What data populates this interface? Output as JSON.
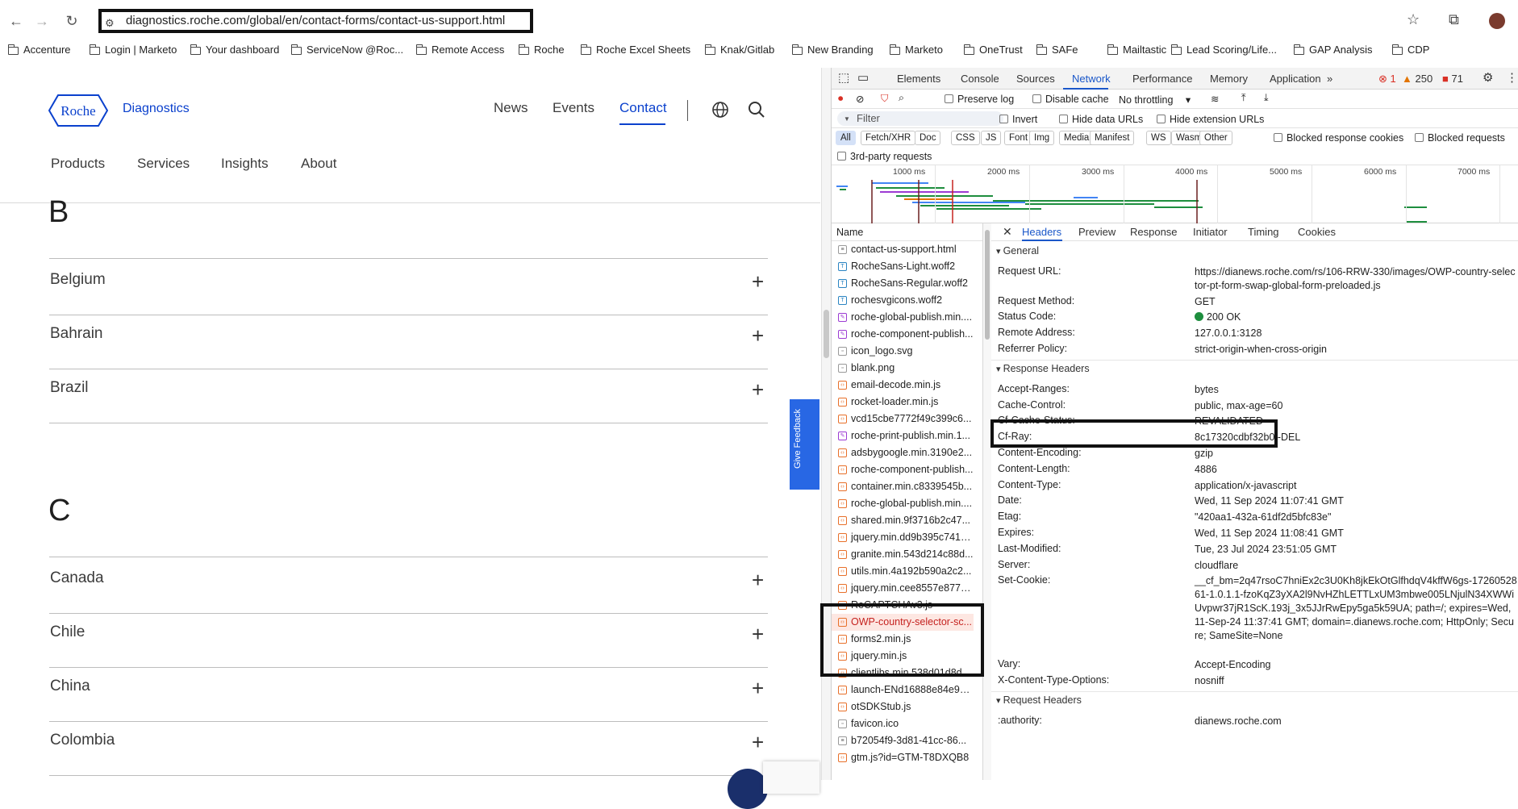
{
  "browser": {
    "url": "diagnostics.roche.com/global/en/contact-forms/contact-us-support.html",
    "bookmarks": [
      "Accenture",
      "Login | Marketo",
      "Your dashboard",
      "ServiceNow @Roc...",
      "Remote Access",
      "Roche",
      "Roche Excel Sheets",
      "Knak/Gitlab",
      "New Branding",
      "Marketo",
      "OneTrust",
      "SAFe",
      "Mailtastic",
      "Lead Scoring/Life...",
      "GAP Analysis",
      "CDP"
    ]
  },
  "site": {
    "logo_text": "Roche",
    "brand_sub": "Diagnostics",
    "topnav": [
      "News",
      "Events",
      "Contact"
    ],
    "subnav": [
      "Products",
      "Services",
      "Insights",
      "About"
    ],
    "letters": [
      "B",
      "C"
    ],
    "countries_b": [
      "Belgium",
      "Bahrain",
      "Brazil"
    ],
    "countries_c": [
      "Canada",
      "Chile",
      "China",
      "Colombia"
    ],
    "plus": "+",
    "feedback": "Give Feedback"
  },
  "devtools": {
    "tabs": [
      "Elements",
      "Console",
      "Sources",
      "Network",
      "Performance",
      "Memory",
      "Application",
      "»"
    ],
    "errors": "1",
    "warnings": "250",
    "issues": "71",
    "preserve_log": "Preserve log",
    "disable_cache": "Disable cache",
    "throttling": "No throttling",
    "filter_placeholder": "Filter",
    "invert": "Invert",
    "hide_data_urls": "Hide data URLs",
    "hide_ext_urls": "Hide extension URLs",
    "types": [
      "All",
      "Fetch/XHR",
      "Doc",
      "CSS",
      "JS",
      "Font",
      "Img",
      "Media",
      "Manifest",
      "WS",
      "Wasm",
      "Other"
    ],
    "blocked_cookies": "Blocked response cookies",
    "blocked_requests": "Blocked requests",
    "third_party": "3rd-party requests",
    "timeline_ticks": [
      "1000 ms",
      "2000 ms",
      "3000 ms",
      "4000 ms",
      "5000 ms",
      "6000 ms",
      "7000 ms"
    ],
    "name_header": "Name",
    "requests": [
      {
        "name": "contact-us-support.html",
        "kind": "doc"
      },
      {
        "name": "RocheSans-Light.woff2",
        "kind": "font"
      },
      {
        "name": "RocheSans-Regular.woff2",
        "kind": "font"
      },
      {
        "name": "rochesvgicons.woff2",
        "kind": "font"
      },
      {
        "name": "roche-global-publish.min....",
        "kind": "css"
      },
      {
        "name": "roche-component-publish...",
        "kind": "css"
      },
      {
        "name": "icon_logo.svg",
        "kind": "img"
      },
      {
        "name": "blank.png",
        "kind": "img"
      },
      {
        "name": "email-decode.min.js",
        "kind": "js"
      },
      {
        "name": "rocket-loader.min.js",
        "kind": "js"
      },
      {
        "name": "vcd15cbe7772f49c399c6...",
        "kind": "js"
      },
      {
        "name": "roche-print-publish.min.1...",
        "kind": "css"
      },
      {
        "name": "adsbygoogle.min.3190e2...",
        "kind": "js"
      },
      {
        "name": "roche-component-publish...",
        "kind": "js"
      },
      {
        "name": "container.min.c8339545b...",
        "kind": "js"
      },
      {
        "name": "roche-global-publish.min....",
        "kind": "js"
      },
      {
        "name": "shared.min.9f3716b2c47...",
        "kind": "js"
      },
      {
        "name": "jquery.min.dd9b395c741c...",
        "kind": "js"
      },
      {
        "name": "granite.min.543d214c88d...",
        "kind": "js"
      },
      {
        "name": "utils.min.4a192b590a2c2...",
        "kind": "js"
      },
      {
        "name": "jquery.min.cee8557e8779...",
        "kind": "js"
      },
      {
        "name": "ReCAPTCHAv3.js",
        "kind": "js"
      },
      {
        "name": "OWP-country-selector-sc...",
        "kind": "js",
        "selected": true
      },
      {
        "name": "forms2.min.js",
        "kind": "js"
      },
      {
        "name": "jquery.min.js",
        "kind": "js"
      },
      {
        "name": "clientlibs.min.538d01d8d...",
        "kind": "js"
      },
      {
        "name": "launch-ENd16888e84e90...",
        "kind": "js"
      },
      {
        "name": "otSDKStub.js",
        "kind": "js"
      },
      {
        "name": "favicon.ico",
        "kind": "img"
      },
      {
        "name": "b72054f9-3d81-41cc-86...",
        "kind": "doc"
      },
      {
        "name": "gtm.js?id=GTM-T8DXQB8",
        "kind": "js"
      }
    ],
    "detail_tabs": [
      "Headers",
      "Preview",
      "Response",
      "Initiator",
      "Timing",
      "Cookies"
    ],
    "general_title": "General",
    "general": [
      {
        "k": "Request URL:",
        "v": "https://dianews.roche.com/rs/106-RRW-330/images/OWP-country-selector-pt-form-swap-global-form-preloaded.js"
      },
      {
        "k": "Request Method:",
        "v": "GET"
      },
      {
        "k": "Status Code:",
        "v": "200 OK"
      },
      {
        "k": "Remote Address:",
        "v": "127.0.0.1:3128"
      },
      {
        "k": "Referrer Policy:",
        "v": "strict-origin-when-cross-origin"
      }
    ],
    "response_title": "Response Headers",
    "response": [
      {
        "k": "Accept-Ranges:",
        "v": "bytes"
      },
      {
        "k": "Cache-Control:",
        "v": "public, max-age=60"
      },
      {
        "k": "Cf-Cache-Status:",
        "v": "REVALIDATED"
      },
      {
        "k": "Cf-Ray:",
        "v": "8c17320cdbf32b0f-DEL"
      },
      {
        "k": "Content-Encoding:",
        "v": "gzip"
      },
      {
        "k": "Content-Length:",
        "v": "4886"
      },
      {
        "k": "Content-Type:",
        "v": "application/x-javascript"
      },
      {
        "k": "Date:",
        "v": "Wed, 11 Sep 2024 11:07:41 GMT"
      },
      {
        "k": "Etag:",
        "v": "\"420aa1-432a-61df2d5bfc83e\""
      },
      {
        "k": "Expires:",
        "v": "Wed, 11 Sep 2024 11:08:41 GMT"
      },
      {
        "k": "Last-Modified:",
        "v": "Tue, 23 Jul 2024 23:51:05 GMT"
      },
      {
        "k": "Server:",
        "v": "cloudflare"
      },
      {
        "k": "Set-Cookie:",
        "v": "__cf_bm=2q47rsoC7hniEx2c3U0Kh8jkEkOtGlfhdqV4kffW6gs-1726052861-1.0.1.1-fzoKqZ3yXA2l9NvHZhLETTLxUM3mbwe005LNjulN34XWWiUvpwr37jR1ScK.193j_3x5JJrRwEpy5ga5k59UA; path=/; expires=Wed, 11-Sep-24 11:37:41 GMT; domain=.dianews.roche.com; HttpOnly; Secure; SameSite=None"
      },
      {
        "k": "Vary:",
        "v": "Accept-Encoding"
      },
      {
        "k": "X-Content-Type-Options:",
        "v": "nosniff"
      }
    ],
    "request_title": "Request Headers",
    "request_headers": [
      {
        "k": ":authority:",
        "v": "dianews.roche.com"
      }
    ]
  },
  "colors": {
    "accent": "#0b41cd",
    "devtools_accent": "#1a57c9",
    "status_ok": "#1e8e3e"
  }
}
